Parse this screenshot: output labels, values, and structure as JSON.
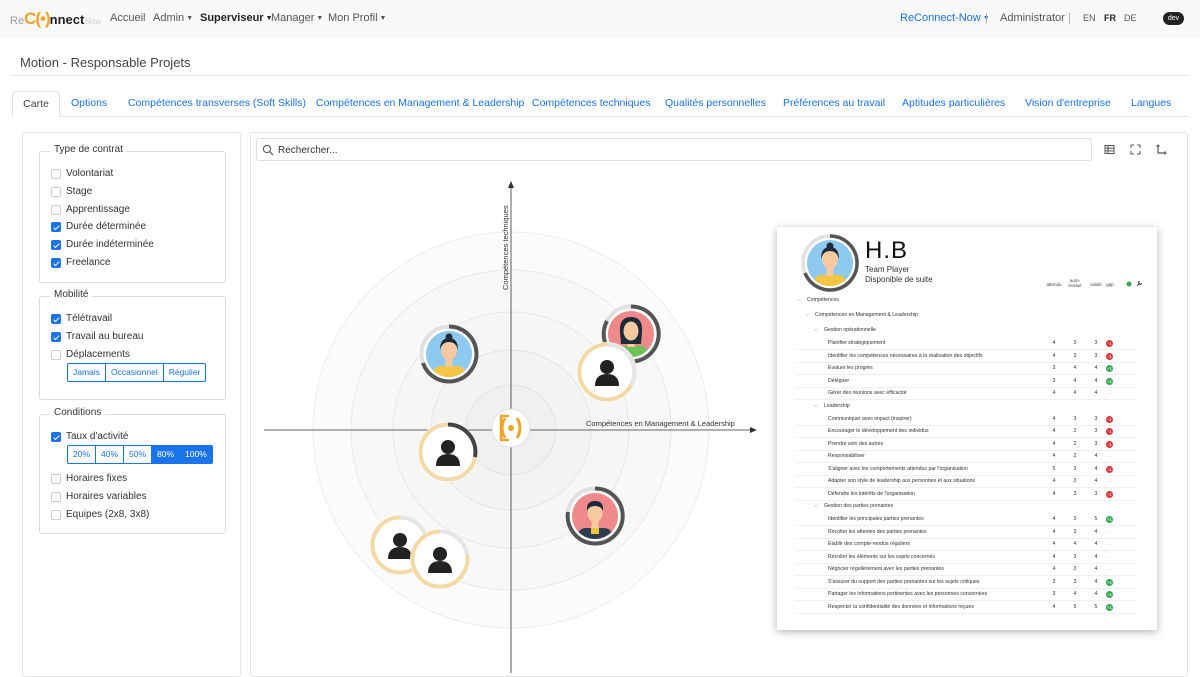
{
  "brand": {
    "re": "Re",
    "mark": "C(•)",
    "nect": "nnect",
    "now": "Now"
  },
  "nav": {
    "items": [
      "Accueil",
      "Admin",
      "Superviseur",
      "Manager",
      "Mon Profil"
    ],
    "right": {
      "org": "ReConnect-Now",
      "separator": "|",
      "user": "Administrator",
      "langs": [
        "EN",
        "FR",
        "DE"
      ],
      "active_lang": "FR",
      "env": "dev"
    }
  },
  "page": {
    "title": "Motion - Responsable Projets"
  },
  "tabs": [
    "Carte",
    "Options",
    "Compétences transverses (Soft Skills)",
    "Compétences en Management & Leadership",
    "Compétences techniques",
    "Qualités personnelles",
    "Préférences au travail",
    "Aptitudes particulières",
    "Vision d'entreprise",
    "Langues"
  ],
  "filters": {
    "contract": {
      "title": "Type de contrat",
      "options": [
        {
          "label": "Volontariat",
          "checked": false
        },
        {
          "label": "Stage",
          "checked": false
        },
        {
          "label": "Apprentissage",
          "checked": false
        },
        {
          "label": "Durée déterminée",
          "checked": true
        },
        {
          "label": "Durée indéterminée",
          "checked": true
        },
        {
          "label": "Freelance",
          "checked": true
        }
      ]
    },
    "mobility": {
      "title": "Mobilité",
      "options": [
        {
          "label": "Télétravail",
          "checked": true
        },
        {
          "label": "Travail au bureau",
          "checked": true
        },
        {
          "label": "Déplacements",
          "checked": false
        }
      ],
      "frequency": [
        "Jamais",
        "Occasionnel",
        "Régulier"
      ]
    },
    "conditions": {
      "title": "Conditions",
      "activity": {
        "label": "Taux d'activité",
        "checked": true
      },
      "rates": [
        "20%",
        "40%",
        "50%",
        "80%",
        "100%"
      ],
      "rates_selected": [
        "80%",
        "100%"
      ],
      "options": [
        {
          "label": "Horaires fixes",
          "checked": false
        },
        {
          "label": "Horaires variables",
          "checked": false
        },
        {
          "label": "Equipes (2x8, 3x8)",
          "checked": false
        }
      ]
    }
  },
  "map": {
    "search_placeholder": "Rechercher...",
    "y_axis_label": "Compétences techniques",
    "x_axis_label": "Compétences en Management & Leadership",
    "tools": [
      "table-icon",
      "fullscreen-icon",
      "axes-icon"
    ]
  },
  "profile": {
    "initials": "H.B",
    "role": "Team Player",
    "availability": "Disponible de suite",
    "columns": [
      "attendu",
      "auto-évalué",
      "validé",
      "gap"
    ],
    "root": "Compétences",
    "category": "Compétences en Management & Leadership",
    "groups": [
      {
        "name": "Gestion opérationnelle",
        "rows": [
          {
            "label": "Planifier stratégiquement",
            "a": "4",
            "b": "3",
            "c": "3",
            "gap": "-1",
            "status": "red"
          },
          {
            "label": "Identifier les compétences nécessaires à la réalisation des objectifs",
            "a": "4",
            "b": "3",
            "c": "3",
            "gap": "-1",
            "status": "red"
          },
          {
            "label": "Évaluer les progrès",
            "a": "3",
            "b": "4",
            "c": "4",
            "gap": "+1",
            "status": "green"
          },
          {
            "label": "Déléguer",
            "a": "3",
            "b": "4",
            "c": "4",
            "gap": "+1",
            "status": "green"
          },
          {
            "label": "Gérer des réunions avec efficacité",
            "a": "4",
            "b": "4",
            "c": "4",
            "gap": "-",
            "status": "none"
          }
        ]
      },
      {
        "name": "Leadership",
        "rows": [
          {
            "label": "Communiquer avec impact (inspirer)",
            "a": "4",
            "b": "3",
            "c": "3",
            "gap": "-1",
            "status": "red"
          },
          {
            "label": "Encourager le développement des individus",
            "a": "4",
            "b": "2",
            "c": "3",
            "gap": "-1",
            "status": "red"
          },
          {
            "label": "Prendre soin des autres",
            "a": "4",
            "b": "2",
            "c": "3",
            "gap": "-1",
            "status": "red"
          },
          {
            "label": "Responsabiliser",
            "a": "4",
            "b": "2",
            "c": "4",
            "gap": "-",
            "status": "none"
          },
          {
            "label": "S'aligner avec les comportements attendus par l'organisation",
            "a": "5",
            "b": "3",
            "c": "4",
            "gap": "-1",
            "status": "red"
          },
          {
            "label": "Adapter son style de leadership aux personnes et aux situations",
            "a": "4",
            "b": "3",
            "c": "4",
            "gap": "-",
            "status": "none"
          },
          {
            "label": "Défendre les intérêts de l'organisation",
            "a": "4",
            "b": "3",
            "c": "3",
            "gap": "-1",
            "status": "red"
          }
        ]
      },
      {
        "name": "Gestion des parties prenantes",
        "rows": [
          {
            "label": "Identifier les principales parties prenantes",
            "a": "4",
            "b": "3",
            "c": "5",
            "gap": "+1",
            "status": "green"
          },
          {
            "label": "Récolter les attentes des parties prenantes",
            "a": "4",
            "b": "3",
            "c": "4",
            "gap": "-",
            "status": "none"
          },
          {
            "label": "Établir des compte-rendus réguliers",
            "a": "4",
            "b": "4",
            "c": "4",
            "gap": "-",
            "status": "none"
          },
          {
            "label": "Récolter les éléments sur les sujets concernés",
            "a": "4",
            "b": "3",
            "c": "4",
            "gap": "-",
            "status": "none"
          },
          {
            "label": "Négocier régulièrement avec les parties prenantes",
            "a": "4",
            "b": "3",
            "c": "4",
            "gap": "-",
            "status": "none"
          },
          {
            "label": "S'assurer du support des parties prenantes sur les sujets critiques",
            "a": "3",
            "b": "3",
            "c": "4",
            "gap": "+1",
            "status": "green"
          },
          {
            "label": "Partager les informations pertinentes avec les personnes concernées",
            "a": "3",
            "b": "4",
            "c": "4",
            "gap": "+1",
            "status": "green"
          },
          {
            "label": "Respecter la confidentialité des données et informations reçues",
            "a": "4",
            "b": "5",
            "c": "5",
            "gap": "+1",
            "status": "green"
          }
        ]
      }
    ]
  },
  "colors": {
    "accent": "#1a73e8",
    "brand": "#f0a52a",
    "gap_negative": "#d9383a",
    "gap_positive": "#34a853"
  }
}
